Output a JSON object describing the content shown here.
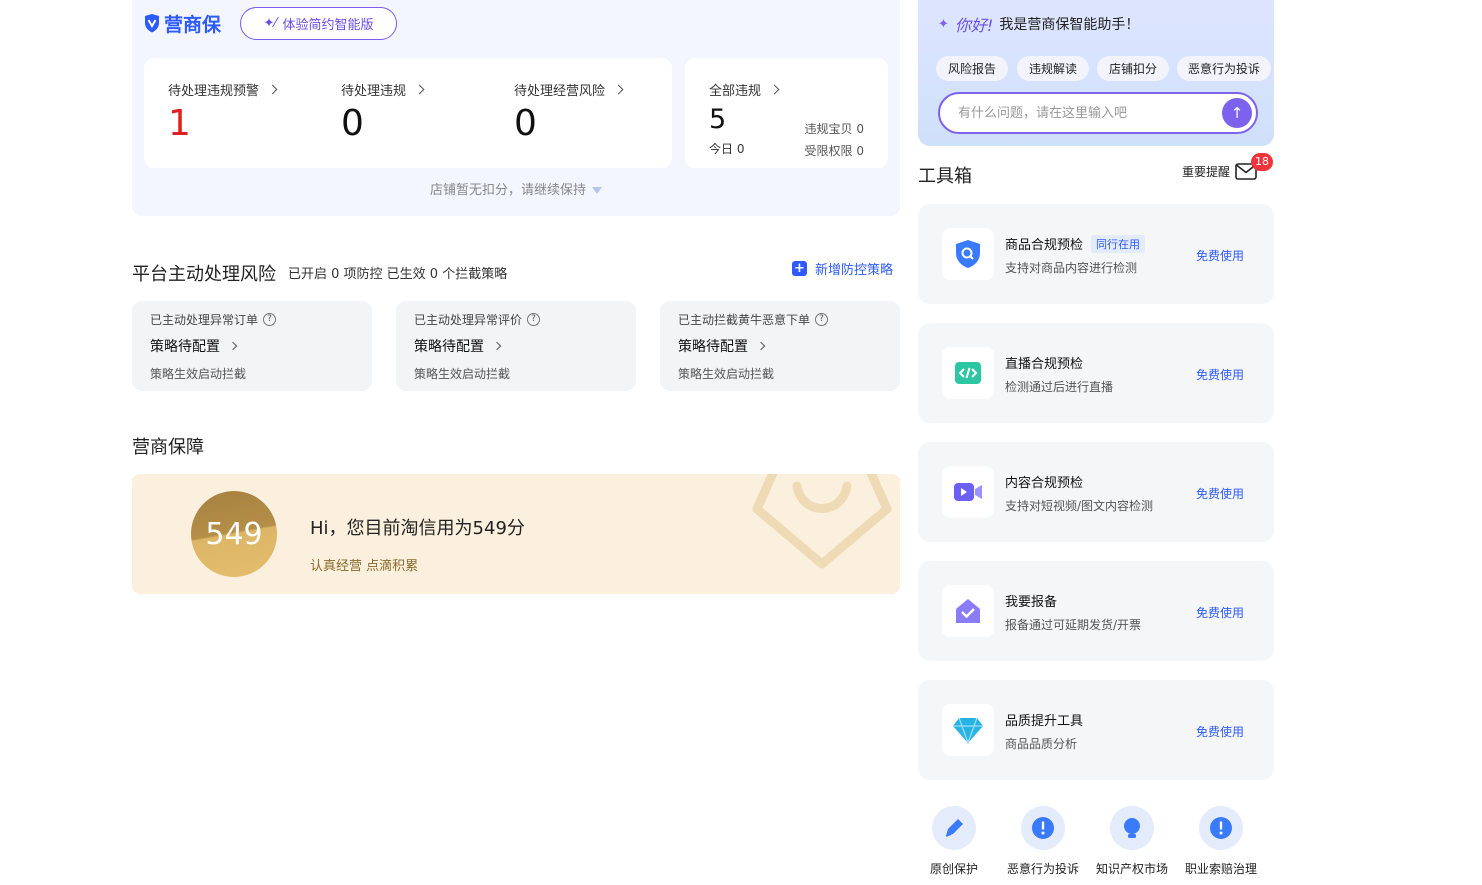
{
  "brand": {
    "logo_text": "营商保",
    "pill_label": "体验简约智能版"
  },
  "stats": [
    {
      "label": "待处理违规预警",
      "value": "1"
    },
    {
      "label": "待处理违规",
      "value": "0"
    },
    {
      "label": "待处理经营风险",
      "value": "0"
    }
  ],
  "all_violations": {
    "label": "全部违规",
    "value": "5",
    "today": "今日 0",
    "items_label": "违规宝贝 0",
    "restricted_label": "受限权限 0"
  },
  "no_deduct_text": "店铺暂无扣分，请继续保持",
  "risk": {
    "title": "平台主动处理风险",
    "subtitle": "已开启 0 项防控 已生效 0 个拦截策略",
    "add_label": "新增防控策略",
    "cards": [
      {
        "title": "已主动处理异常订单",
        "main": "策略待配置",
        "sub": "策略生效启动拦截"
      },
      {
        "title": "已主动处理异常评价",
        "main": "策略待配置",
        "sub": "策略生效启动拦截"
      },
      {
        "title": "已主动拦截黄牛恶意下单",
        "main": "策略待配置",
        "sub": "策略生效启动拦截"
      }
    ]
  },
  "guarantee": {
    "title": "营商保障",
    "score": "549",
    "hi_text": "Hi，您目前淘信用为549分",
    "motto": "认真经营 点滴积累"
  },
  "assistant": {
    "greeting_hi": "你好!",
    "greeting_text": "我是营商保智能助手！",
    "chips": [
      "风险报告",
      "违规解读",
      "店铺扣分",
      "恶意行为投诉"
    ],
    "input_placeholder": "有什么问题，请在这里输入吧"
  },
  "toolbox": {
    "title": "工具箱",
    "notice_label": "重要提醒",
    "notice_count": "18",
    "tools": [
      {
        "name": "商品合规预检",
        "tag": "同行在用",
        "desc": "支持对商品内容进行检测",
        "action": "免费使用",
        "icon": "shield-search-icon"
      },
      {
        "name": "直播合规预检",
        "tag": "",
        "desc": "检测通过后进行直播",
        "action": "免费使用",
        "icon": "code-icon"
      },
      {
        "name": "内容合规预检",
        "tag": "",
        "desc": "支持对短视频/图文内容检测",
        "action": "免费使用",
        "icon": "video-icon"
      },
      {
        "name": "我要报备",
        "tag": "",
        "desc": "报备通过可延期发货/开票",
        "action": "免费使用",
        "icon": "report-icon"
      },
      {
        "name": "品质提升工具",
        "tag": "",
        "desc": "商品品质分析",
        "action": "免费使用",
        "icon": "diamond-icon"
      }
    ]
  },
  "bottom_nav": [
    {
      "label": "原创保护",
      "icon": "pen-icon"
    },
    {
      "label": "恶意行为投诉",
      "icon": "alert-icon"
    },
    {
      "label": "知识产权市场",
      "icon": "bulb-icon"
    },
    {
      "label": "职业索赔治理",
      "icon": "alert-icon"
    }
  ],
  "colors": {
    "accent": "#2e5bff",
    "purple": "#7d62ee",
    "alert_red": "#e02020",
    "gold": "#dcb566"
  }
}
